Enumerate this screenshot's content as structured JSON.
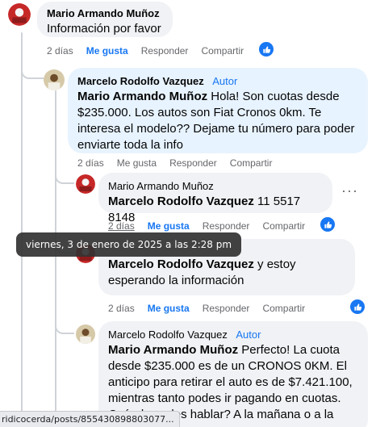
{
  "comments": [
    {
      "author": "Mario Armando Muñoz",
      "text": "Información por favor",
      "time": "2 días",
      "like": "Me gusta",
      "reply": "Responder",
      "share": "Compartir"
    },
    {
      "author": "Marcelo Rodolfo Vazquez",
      "badge": "Autor",
      "mention": "Mario Armando Muñoz",
      "text": " Hola! Son cuotas desde $235.000. Los autos son Fiat Cronos 0km. Te interesa el modelo?? Dejame tu número para poder enviarte toda la info",
      "time": "2 días",
      "like": "Me gusta",
      "reply": "Responder",
      "share": "Compartir"
    },
    {
      "author": "Mario Armando Muñoz",
      "mention": "Marcelo Rodolfo Vazquez",
      "text": " 11 5517 8148",
      "time": "2 días",
      "like": "Me gusta",
      "reply": "Responder",
      "share": "Compartir"
    },
    {
      "mention": "Marcelo Rodolfo Vazquez",
      "text": " y estoy esperando la información",
      "time": "2 días",
      "like": "Me gusta",
      "reply": "Responder",
      "share": "Compartir"
    },
    {
      "author": "Marcelo Rodolfo Vazquez",
      "badge": "Autor",
      "mention": "Mario Armando Muñoz",
      "text": " Perfecto! La cuota desde $235.000 es de un CRONOS 0KM. El anticipo para retirar el auto es de $7.421.100, mientras tanto podes ir pagando en cuotas. Cuándo podes hablar? A la mañana o a la"
    }
  ],
  "tooltip": "viernes, 3 de enero de 2025 a las 2:28 pm",
  "status_url": "ridicocerda/posts/855430898803077...",
  "icons": {
    "more": "more-options-icon",
    "like_reaction": "thumbs-up-icon"
  },
  "colors": {
    "accent": "#1877f2",
    "bubble": "#f0f2f5",
    "bubble_highlight": "#e7f3ff",
    "meta_text": "#65676b"
  }
}
